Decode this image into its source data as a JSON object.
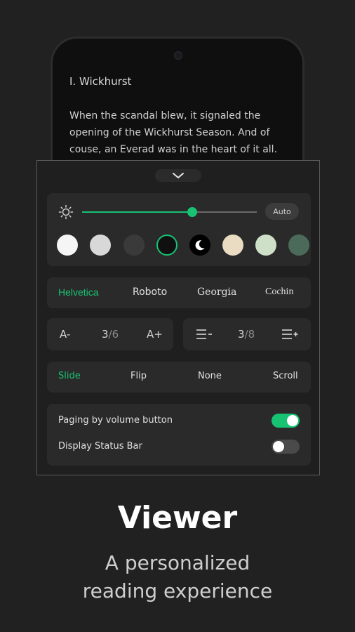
{
  "reader": {
    "chapter_title": "I. Wickhurst",
    "paragraph": "When the scandal blew, it signaled the opening of the Wickhurst Season. And of couse, an Everad was in the heart of it all."
  },
  "settings": {
    "brightness": {
      "auto_label": "Auto",
      "level": 0.63,
      "accent": "#18c273"
    },
    "themes": [
      {
        "color": "#f5f5f5"
      },
      {
        "color": "#d8d8d8"
      },
      {
        "color": "#3a3a3a"
      },
      {
        "color": "#101010",
        "selected": true
      },
      {
        "color": "#000000",
        "icon": "moon-icon"
      },
      {
        "color": "#e9dcc3"
      },
      {
        "color": "#cfe0c9"
      },
      {
        "color": "#4c6a5a"
      }
    ],
    "fonts": [
      {
        "label": "Helvetica",
        "active": true
      },
      {
        "label": "Roboto"
      },
      {
        "label": "Georgia"
      },
      {
        "label": "Cochin"
      }
    ],
    "font_size": {
      "minus": "A-",
      "current": "3",
      "total": "/6",
      "plus": "A+"
    },
    "line_spacing": {
      "current": "3",
      "total": "/8"
    },
    "transitions": [
      {
        "label": "Slide",
        "active": true
      },
      {
        "label": "Flip"
      },
      {
        "label": "None"
      },
      {
        "label": "Scroll"
      }
    ],
    "toggles": [
      {
        "label": "Paging by volume button",
        "on": true
      },
      {
        "label": "Display Status Bar",
        "on": false
      }
    ]
  },
  "promo": {
    "headline": "Viewer",
    "subtitle_line1": "A personalized",
    "subtitle_line2": "reading experience"
  }
}
